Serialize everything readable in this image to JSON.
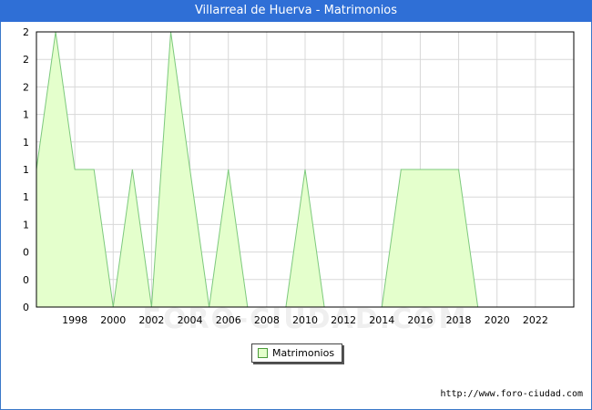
{
  "title": "Villarreal de Huerva - Matrimonios",
  "watermark": "FORO-CIUDAD.COM",
  "source": "http://www.foro-ciudad.com",
  "colors": {
    "title_bg": "#2f6fd6",
    "area_fill": "#e4ffcc",
    "area_line": "#7dc97d",
    "grid": "#d8d8d8"
  },
  "chart_data": {
    "type": "area",
    "title": "Villarreal de Huerva - Matrimonios",
    "x": [
      1996,
      1997,
      1998,
      1999,
      2000,
      2001,
      2002,
      2003,
      2004,
      2005,
      2006,
      2007,
      2008,
      2009,
      2010,
      2011,
      2012,
      2013,
      2014,
      2015,
      2016,
      2017,
      2018,
      2019,
      2020,
      2021,
      2022,
      2023
    ],
    "series": [
      {
        "name": "Matrimonios",
        "values": [
          1,
          2,
          1,
          1,
          0,
          1,
          0,
          2,
          1,
          0,
          1,
          0,
          0,
          0,
          1,
          0,
          0,
          0,
          0,
          1,
          1,
          1,
          1,
          0,
          0,
          0,
          0,
          0
        ]
      }
    ],
    "xlim": [
      1996,
      2024
    ],
    "ylim": [
      0,
      2
    ],
    "x_ticks": [
      "1998",
      "2000",
      "2002",
      "2004",
      "2006",
      "2008",
      "2010",
      "2012",
      "2014",
      "2016",
      "2018",
      "2020",
      "2022"
    ],
    "y_tick_labels": [
      "0",
      "0",
      "0",
      "1",
      "1",
      "1",
      "1",
      "1",
      "2",
      "2",
      "2"
    ],
    "grid": true,
    "legend_position": "bottom-center"
  }
}
